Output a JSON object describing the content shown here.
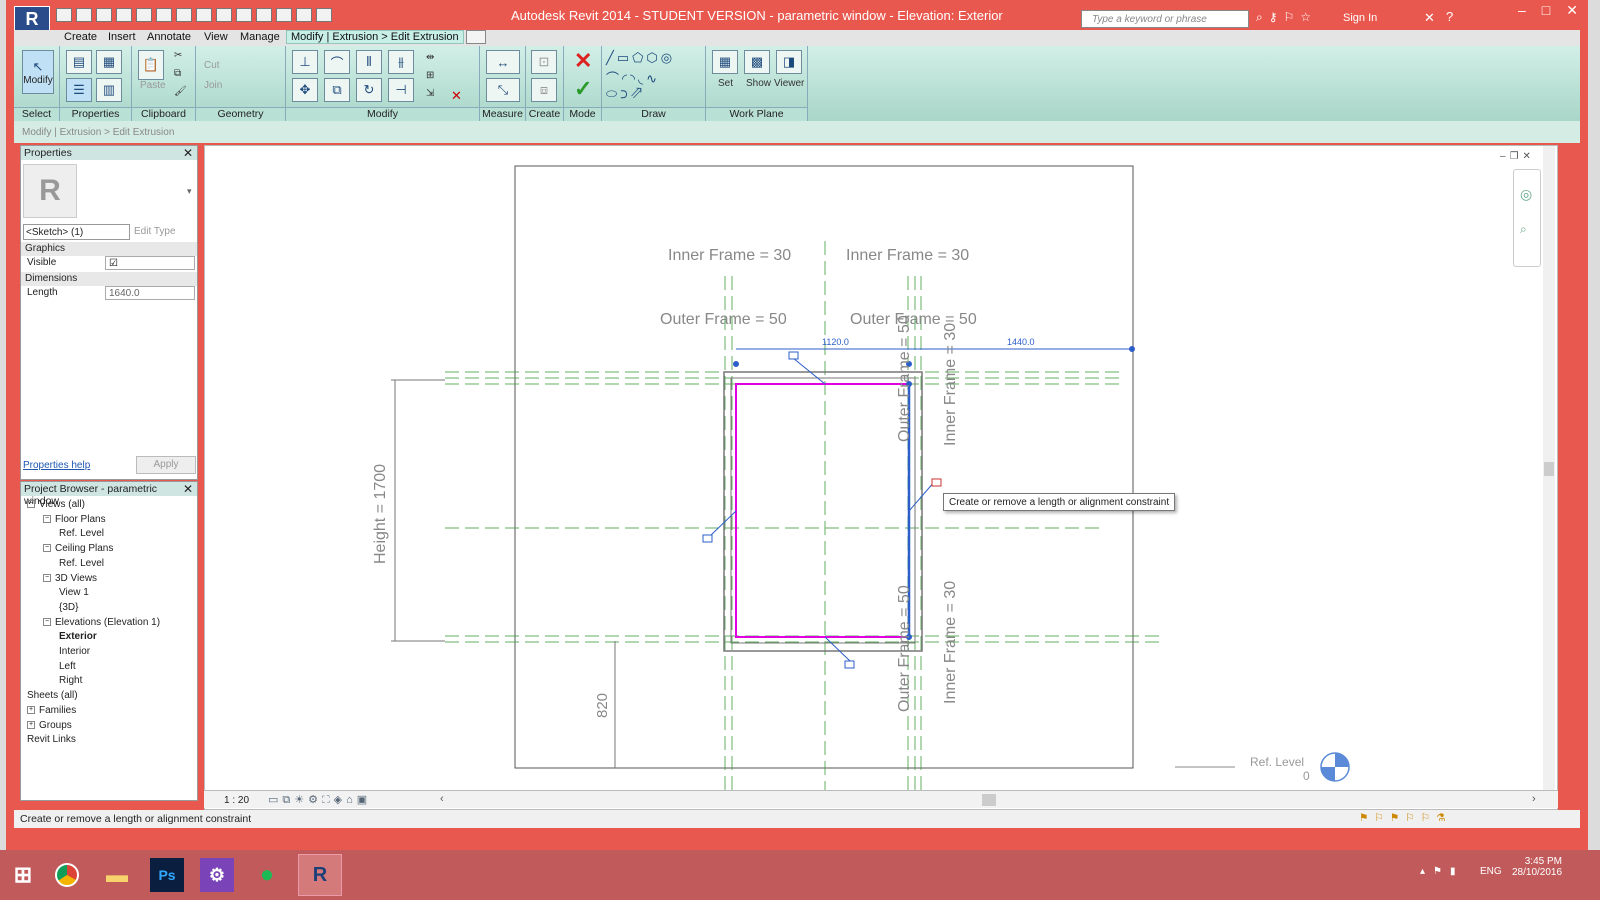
{
  "window": {
    "title": "Autodesk Revit 2014 - STUDENT VERSION -      parametric window - Elevation: Exterior",
    "search_placeholder": "Type a keyword or phrase",
    "sign_in": "Sign In",
    "accent": "#e9584f"
  },
  "menu": {
    "items": [
      "Create",
      "Insert",
      "Annotate",
      "View",
      "Manage"
    ],
    "active_tab": "Modify | Extrusion > Edit Extrusion"
  },
  "ribbon": {
    "modify_label": "Modify",
    "select_label": "Select",
    "properties_label": "Properties",
    "paste_label": "Paste",
    "clipboard_label": "Clipboard",
    "cut_label": "Cut",
    "join_label": "Join",
    "geometry_label": "Geometry",
    "modify_group_label": "Modify",
    "measure_label": "Measure",
    "create_label": "Create",
    "mode_label": "Mode",
    "draw_label": "Draw",
    "set_label": "Set",
    "show_label": "Show",
    "viewer_label": "Viewer",
    "work_plane_label": "Work Plane"
  },
  "options_bar": "Modify | Extrusion > Edit Extrusion",
  "properties": {
    "title": "Properties",
    "type_selector": "<Sketch> (1)",
    "edit_type": "Edit Type",
    "graphics_label": "Graphics",
    "visible_label": "Visible",
    "visible_checked": true,
    "dimensions_label": "Dimensions",
    "length_label": "Length",
    "length_value": "1640.0",
    "help_link": "Properties help",
    "apply_label": "Apply"
  },
  "project_browser": {
    "title": "Project Browser - parametric window",
    "tree": [
      {
        "label": "Views (all)",
        "level": 0,
        "toggle": "−"
      },
      {
        "label": "Floor Plans",
        "level": 1,
        "toggle": "−"
      },
      {
        "label": "Ref. Level",
        "level": 2
      },
      {
        "label": "Ceiling Plans",
        "level": 1,
        "toggle": "−"
      },
      {
        "label": "Ref. Level",
        "level": 2
      },
      {
        "label": "3D Views",
        "level": 1,
        "toggle": "−"
      },
      {
        "label": "View 1",
        "level": 2
      },
      {
        "label": "{3D}",
        "level": 2
      },
      {
        "label": "Elevations (Elevation 1)",
        "level": 1,
        "toggle": "−"
      },
      {
        "label": "Exterior",
        "level": 2,
        "bold": true
      },
      {
        "label": "Interior",
        "level": 2
      },
      {
        "label": "Left",
        "level": 2
      },
      {
        "label": "Right",
        "level": 2
      },
      {
        "label": "Sheets (all)",
        "level": 0
      },
      {
        "label": "Families",
        "level": 0,
        "toggle": "+"
      },
      {
        "label": "Groups",
        "level": 0,
        "toggle": "+"
      },
      {
        "label": "Revit Links",
        "level": 0
      }
    ]
  },
  "drawing": {
    "inner_frame_top_left": "Inner Frame = 30",
    "inner_frame_top_right": "Inner Frame = 30",
    "outer_frame_left": "Outer Frame = 50",
    "outer_frame_right": "Outer Frame = 50",
    "dim_1120": "1120.0",
    "dim_1440": "1440.0",
    "height": "Height = 1700",
    "outer_frame_vert_top": "Outer Frame = 50",
    "inner_frame_vert_top": "Inner Frame = 30",
    "outer_frame_vert_bottom": "Outer Frame = 50",
    "inner_frame_vert_bottom": "Inner Frame = 30",
    "dim_820": "820",
    "ref_level": "Ref. Level",
    "ref_level_value": "0",
    "sketch_color": "#e000e0",
    "ref_plane_color": "#3c9c3c",
    "dim_color": "#2b5ec9"
  },
  "tooltip": "Create or remove a length or alignment constraint",
  "view_control": {
    "scale": "1 : 20"
  },
  "status_bar": "Create or remove a length or alignment constraint",
  "taskbar": {
    "language": "ENG",
    "time": "3:45 PM",
    "date": "28/10/2016"
  }
}
